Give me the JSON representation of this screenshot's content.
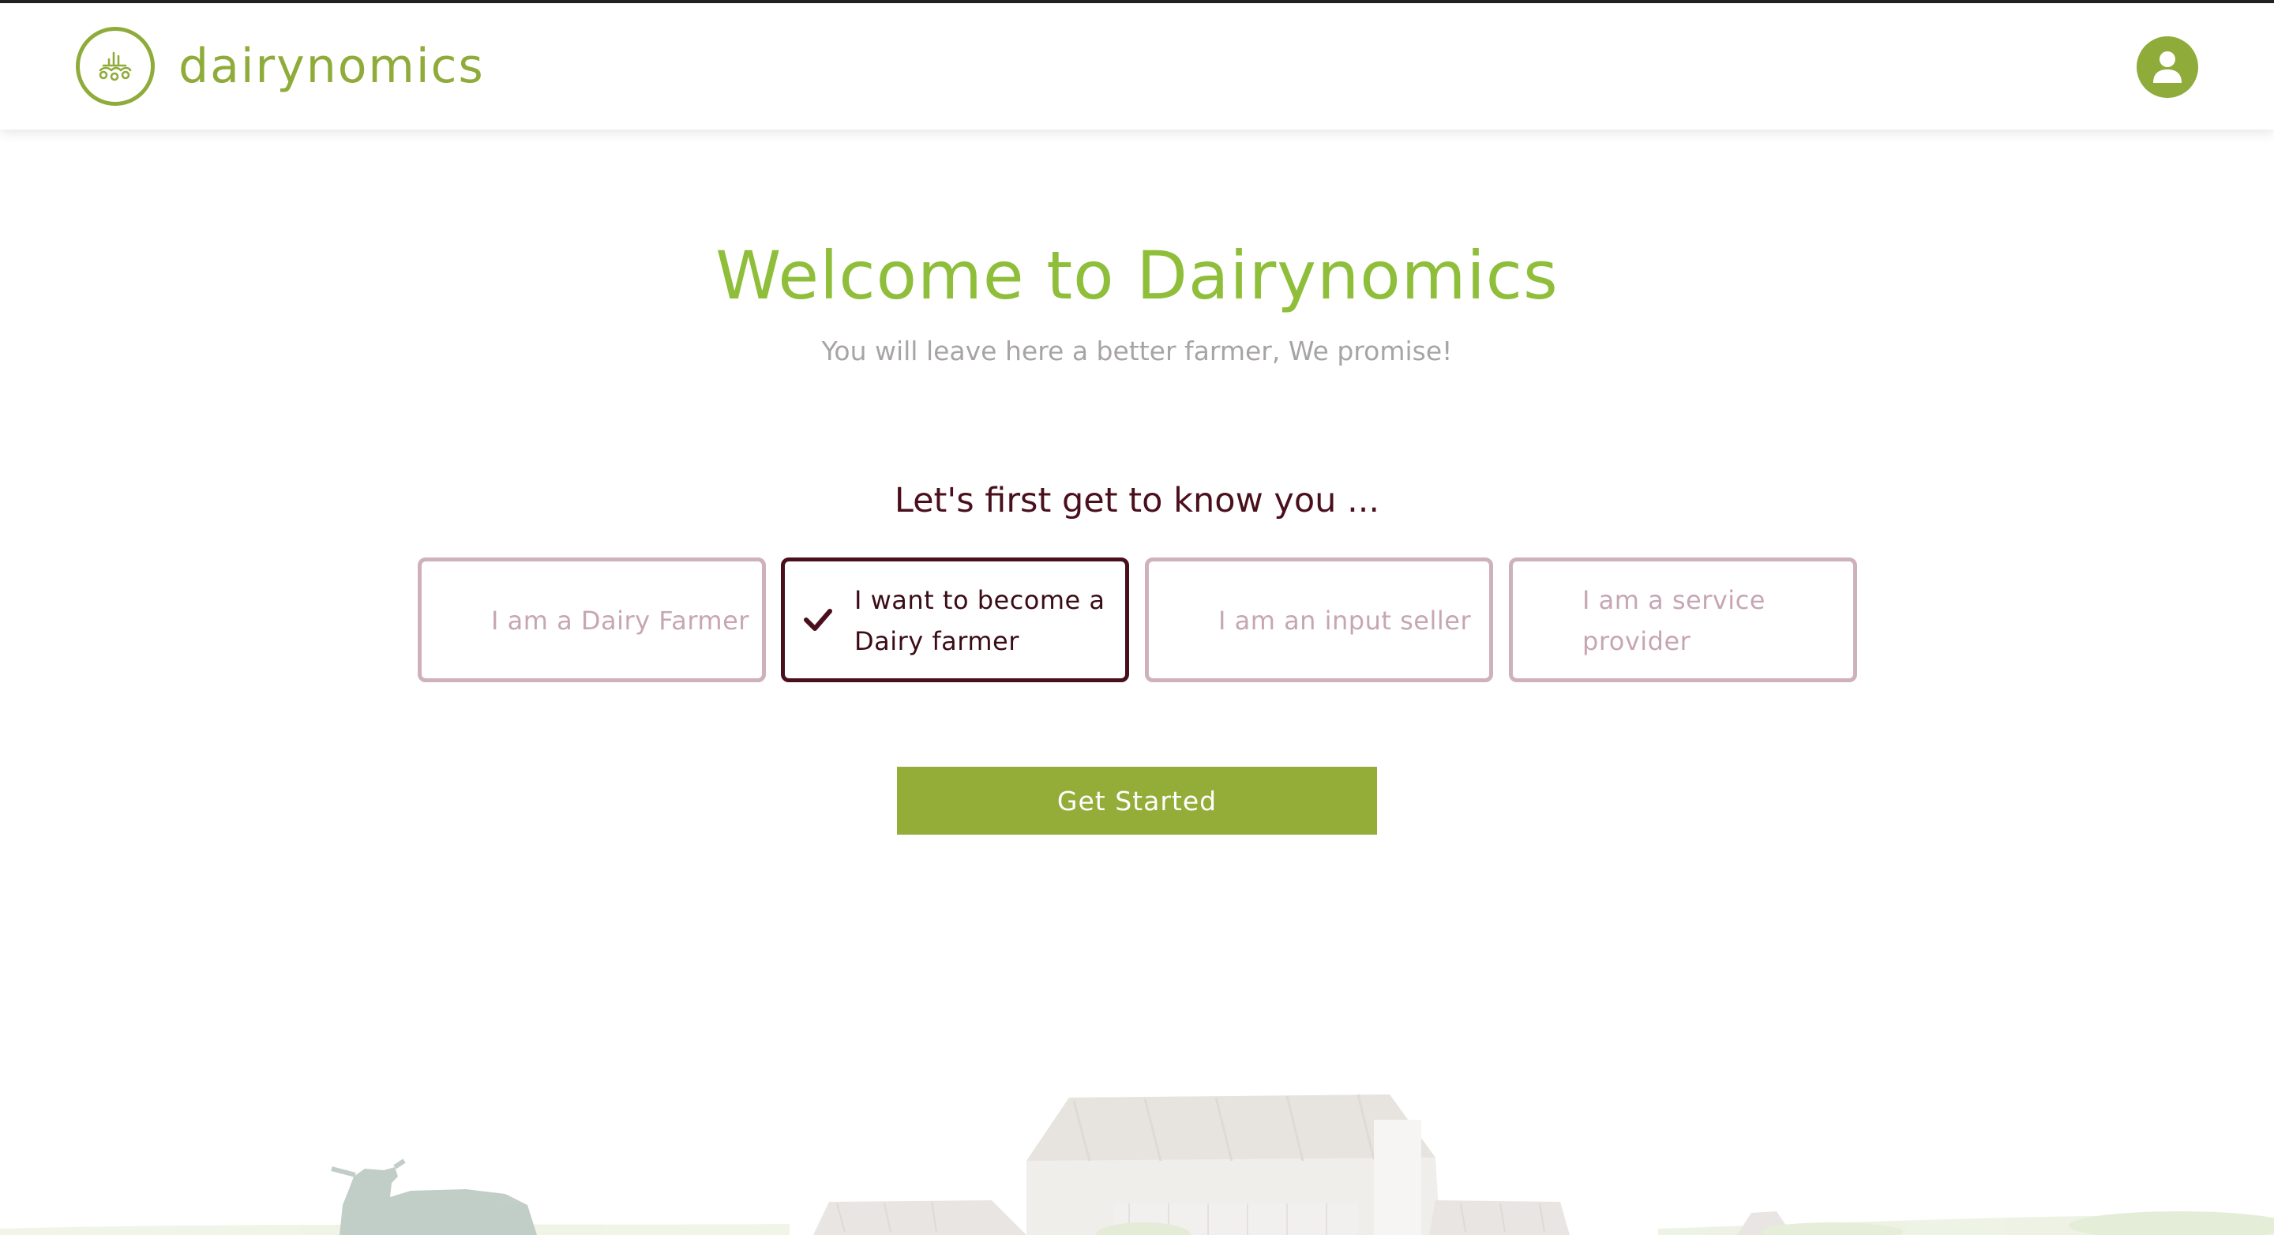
{
  "header": {
    "brand_name": "dairynomics",
    "logo_icon": "milk-drop-chart-icon",
    "user_icon": "user-icon",
    "accent_color": "#8fab3a"
  },
  "hero": {
    "title": "Welcome to Dairynomics",
    "subtitle": "You will leave here a better farmer, We promise!",
    "title_color": "#8fbe3a"
  },
  "onboarding": {
    "question": "Let's first get to know you ...",
    "roles": [
      {
        "label": "I am a Dairy Farmer",
        "selected": false
      },
      {
        "label": "I want to become a Dairy farmer",
        "selected": true,
        "icon": "checkmark-icon"
      },
      {
        "label": "I am an input seller",
        "selected": false
      },
      {
        "label": "I am a service provider",
        "selected": false
      }
    ],
    "selected_border_color": "#4a0f1c",
    "unselected_border_color": "#cfb1bd",
    "submit_label": "Get Started",
    "submit_color": "#93ad38"
  },
  "background": {
    "illustration": "farm-scene-illustration"
  }
}
